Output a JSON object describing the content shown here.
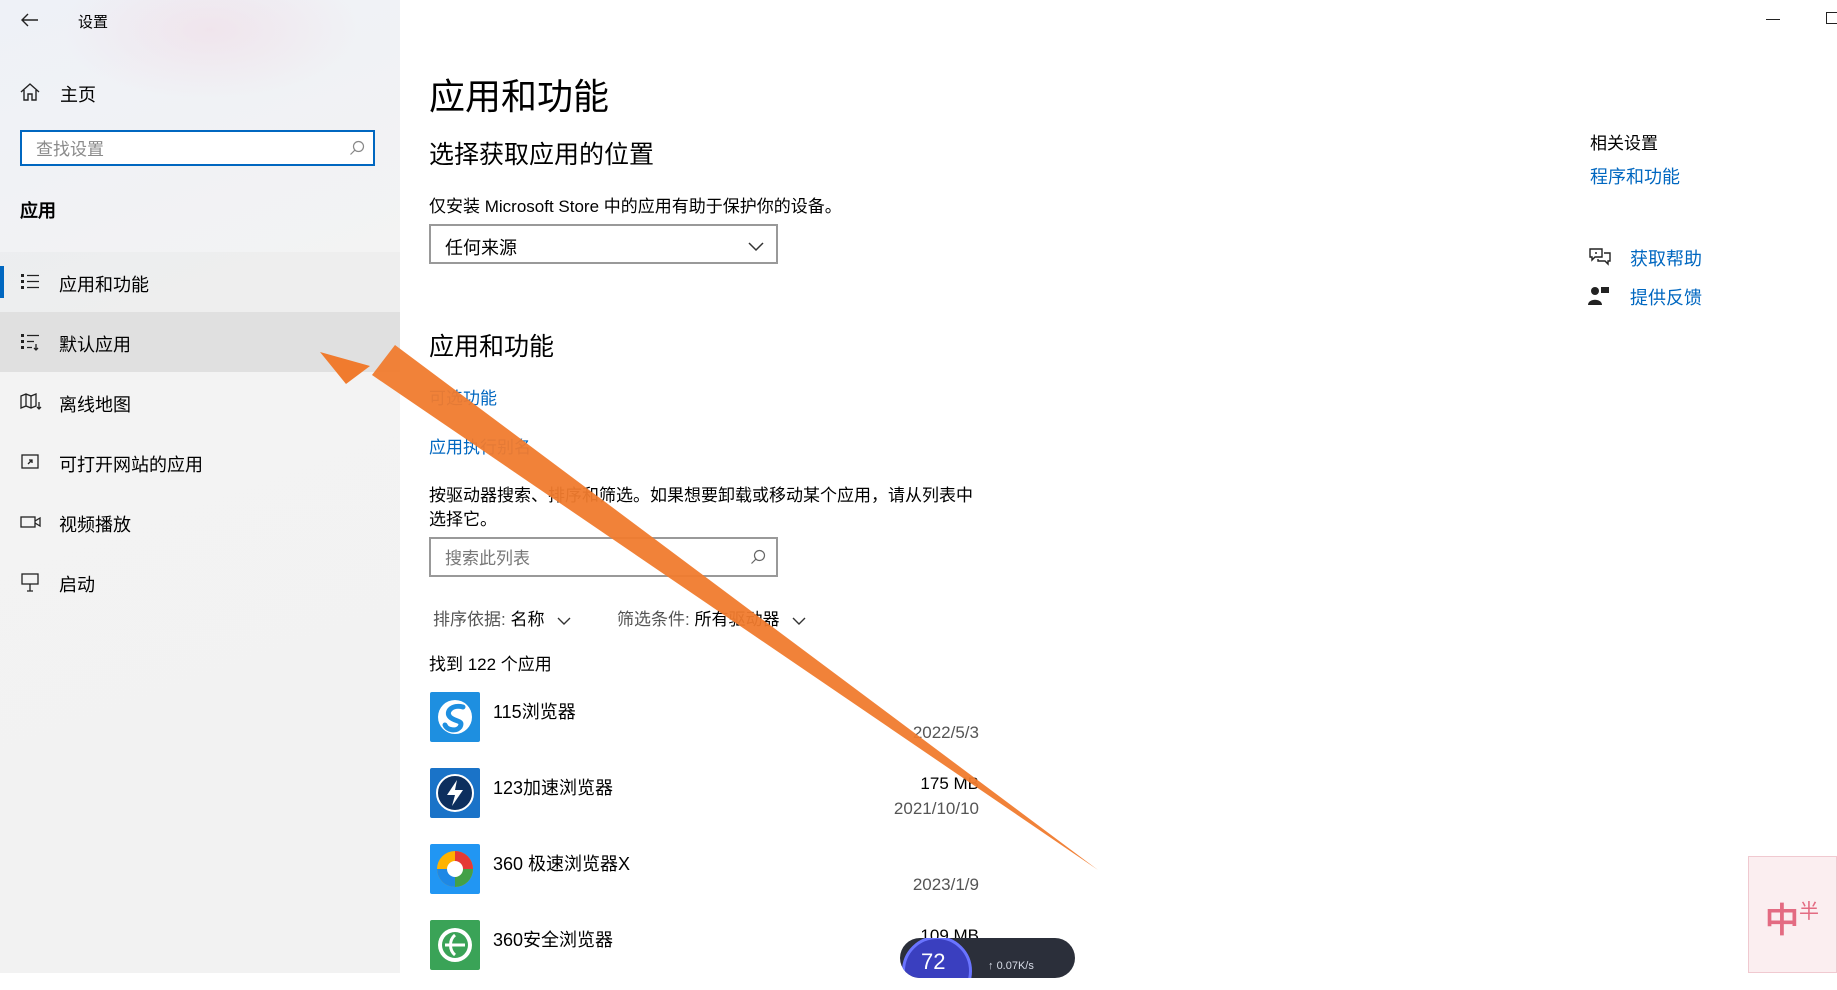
{
  "window": {
    "title": "设置"
  },
  "sidebar": {
    "home_label": "主页",
    "search_placeholder": "查找设置",
    "section_title": "应用",
    "items": [
      {
        "label": "应用和功能",
        "icon": "apps-list-icon"
      },
      {
        "label": "默认应用",
        "icon": "default-apps-icon"
      },
      {
        "label": "离线地图",
        "icon": "offline-map-icon"
      },
      {
        "label": "可打开网站的应用",
        "icon": "web-apps-icon"
      },
      {
        "label": "视频播放",
        "icon": "video-icon"
      },
      {
        "label": "启动",
        "icon": "startup-icon"
      }
    ],
    "selected_index": 0,
    "hover_index": 1
  },
  "main": {
    "page_title": "应用和功能",
    "install_section": {
      "heading": "选择获取应用的位置",
      "description": "仅安装 Microsoft Store 中的应用有助于保护你的设备。",
      "dropdown_value": "任何来源"
    },
    "apps_section": {
      "heading": "应用和功能",
      "optional_features_link": "可选功能",
      "aliases_link": "应用执行别名",
      "description_line1": "按驱动器搜索、排序和筛选。如果想要卸载或移动某个应用，请从列表中",
      "description_line2": "选择它。",
      "search_placeholder": "搜索此列表",
      "sort_label": "排序依据:",
      "sort_value": "名称",
      "filter_label": "筛选条件:",
      "filter_value": "所有驱动器",
      "count_text": "找到 122 个应用",
      "apps": [
        {
          "name": "115浏览器",
          "size": "",
          "date": "2022/5/3",
          "icon_color": "#1e8fe0"
        },
        {
          "name": "123加速浏览器",
          "size": "175 MB",
          "date": "2021/10/10",
          "icon_color": "#1a73c8"
        },
        {
          "name": "360 极速浏览器X",
          "size": "",
          "date": "2023/1/9",
          "icon_color": "#2196f3"
        },
        {
          "name": "360安全浏览器",
          "size": "109 MB",
          "date": "",
          "icon_color": "#3aa357"
        }
      ]
    }
  },
  "related": {
    "heading": "相关设置",
    "programs_link": "程序和功能",
    "help_label": "获取帮助",
    "feedback_label": "提供反馈"
  },
  "widget": {
    "value": "72",
    "speed": "0.07K/s"
  },
  "colors": {
    "accent": "#0067c0",
    "arrow": "#f07b2e",
    "sidebar_bg": "#f2f2f2"
  }
}
